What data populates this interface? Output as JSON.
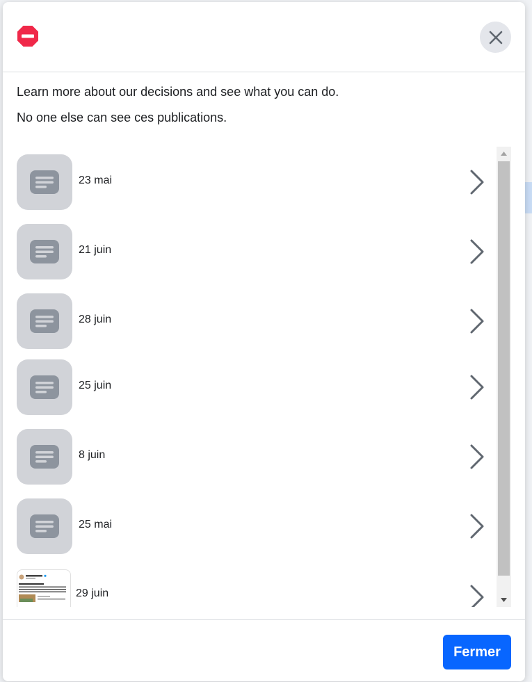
{
  "header": {
    "status_icon": "stop-sign-icon",
    "close_icon": "close-icon"
  },
  "intro": {
    "line1": "Learn more about our decisions and see what you can do.",
    "line2": "No one else can see ces publications."
  },
  "posts": [
    {
      "date": "23 mai",
      "thumbnail": "post-placeholder-icon"
    },
    {
      "date": "21 juin",
      "thumbnail": "post-placeholder-icon"
    },
    {
      "date": "28 juin",
      "thumbnail": "post-placeholder-icon"
    },
    {
      "date": "25 juin",
      "thumbnail": "post-placeholder-icon"
    },
    {
      "date": "8 juin",
      "thumbnail": "post-placeholder-icon"
    },
    {
      "date": "25 mai",
      "thumbnail": "post-placeholder-icon"
    },
    {
      "date": "29 juin",
      "thumbnail": "post-screenshot-thumbnail"
    }
  ],
  "footer": {
    "close_label": "Fermer"
  },
  "colors": {
    "primary": "#0866ff",
    "stop_red": "#f02849",
    "thumb_bg": "#d1d3d8",
    "thumb_icon": "#8d949e"
  }
}
